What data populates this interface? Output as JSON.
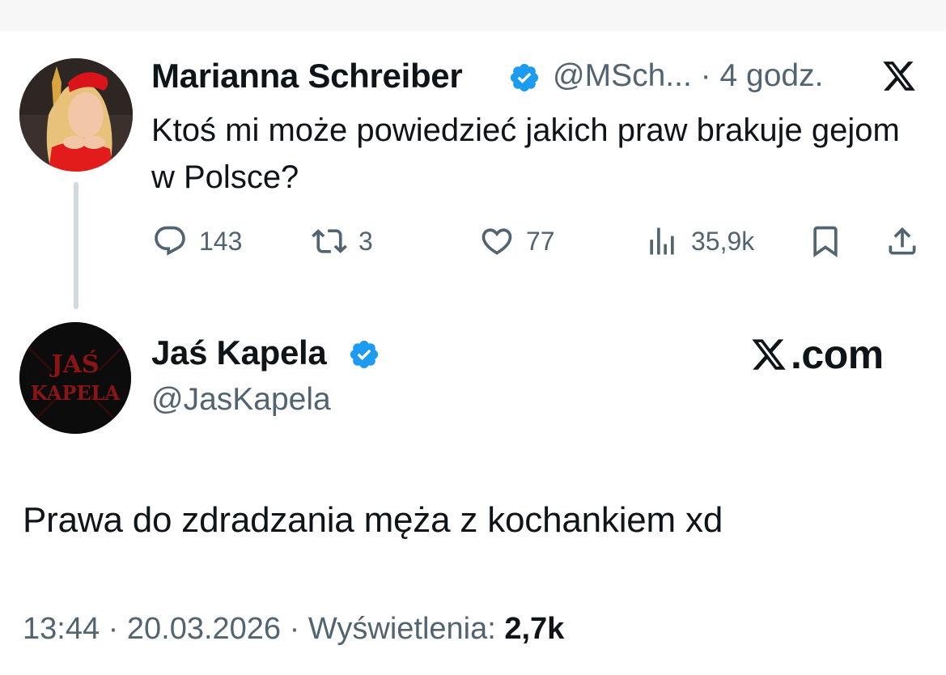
{
  "original_tweet": {
    "author_name": "Marianna Schreiber",
    "handle": "@MSch...",
    "separator": "·",
    "time": "4 godz.",
    "text": "Ktoś mi może powiedzieć jakich praw brakuje gejom w Polsce?",
    "stats": {
      "replies": "143",
      "retweets": "3",
      "likes": "77",
      "views": "35,9k"
    }
  },
  "reply_tweet": {
    "author_name": "Jaś Kapela",
    "handle": "@JasKapela",
    "avatar_text_line1": "JAŚ",
    "avatar_text_line2": "KAPELA",
    "site_label": ".com",
    "text": "Prawa do zdradzania męża z kochankiem xd",
    "time": "13:44",
    "date": "20.03.2026",
    "views_label": "Wyświetlenia:",
    "views_count": "2,7k"
  },
  "colors": {
    "verified_blue": "#1d9bf0",
    "muted_text": "#536471",
    "primary_text": "#0f1419",
    "thread_line": "#cfd9de"
  },
  "icons": [
    "x-logo-icon",
    "verified-badge-icon",
    "reply-icon",
    "retweet-icon",
    "like-icon",
    "views-icon",
    "bookmark-icon",
    "share-icon"
  ]
}
